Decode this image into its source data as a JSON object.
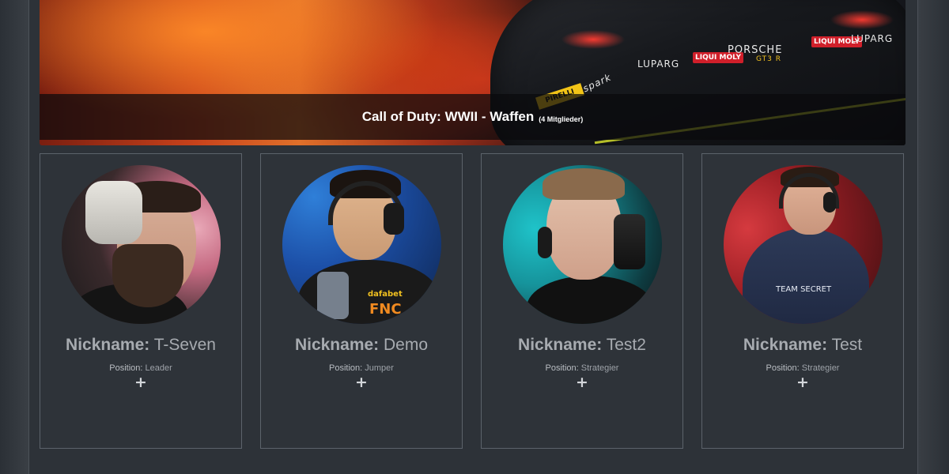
{
  "banner": {
    "title": "Call of Duty: WWII - Waffen",
    "members": "(4 Mitglieder)",
    "car_texts": {
      "luparg": "LUPARG",
      "liqui": "LIQUI MOLY",
      "porsche": "PORSCHE",
      "gt3r": "GT3 R",
      "spark": "spark",
      "pirelli": "PIRELLI"
    }
  },
  "members": [
    {
      "nickname_label": "Nickname:",
      "nickname": "T-Seven",
      "position_label": "Position:",
      "position": "Leader",
      "expand": "+"
    },
    {
      "nickname_label": "Nickname:",
      "nickname": "Demo",
      "position_label": "Position:",
      "position": "Jumper",
      "expand": "+"
    },
    {
      "nickname_label": "Nickname:",
      "nickname": "Test2",
      "position_label": "Position:",
      "position": "Strategier",
      "expand": "+"
    },
    {
      "nickname_label": "Nickname:",
      "nickname": "Test",
      "position_label": "Position:",
      "position": "Strategier",
      "expand": "+"
    }
  ],
  "avatar_team_text": {
    "dafabet": "dafabet",
    "team_secret": "TEAM SECRET",
    "fnatic": "FNC"
  }
}
